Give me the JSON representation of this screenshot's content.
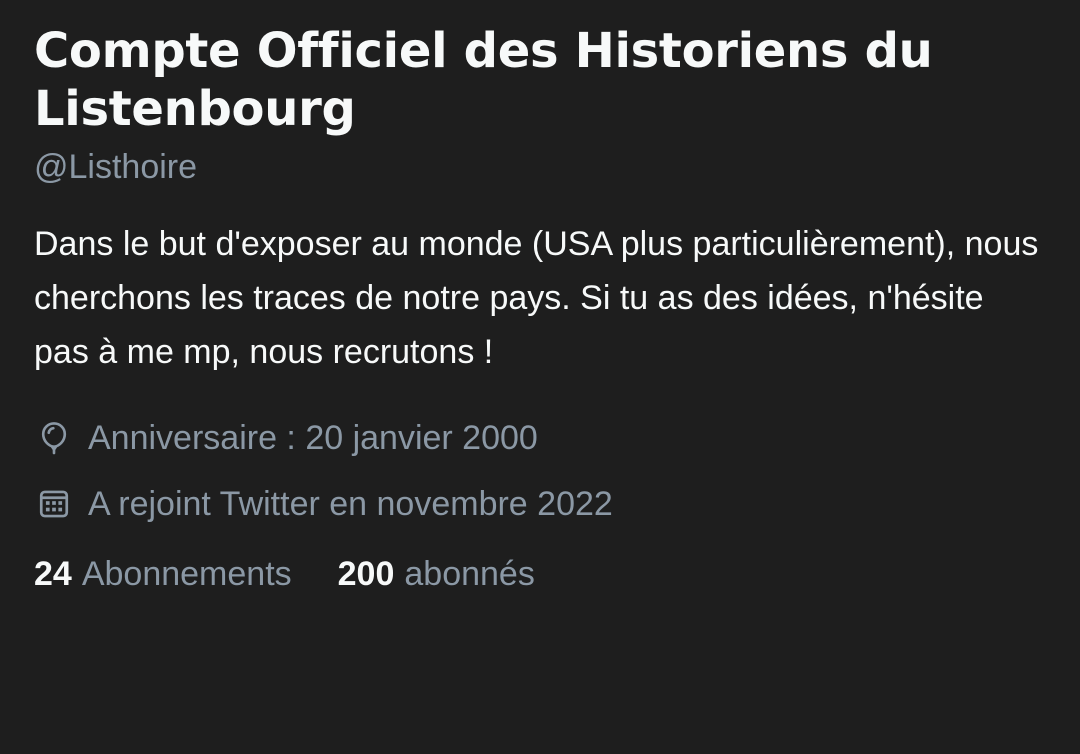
{
  "profile": {
    "display_name": "Compte Officiel des Historiens du Listenbourg",
    "handle": "@Listhoire",
    "bio": "Dans le but d'exposer au monde (USA plus particulièrement), nous cherchons les traces de notre pays. Si tu as des idées, n'hésite pas à me mp, nous recrutons !",
    "birthday": {
      "icon": "balloon-icon",
      "text": "Anniversaire : 20 janvier 2000"
    },
    "joined": {
      "icon": "calendar-icon",
      "text": "A rejoint Twitter en novembre 2022"
    },
    "following": {
      "count": "24",
      "label": "Abonnements"
    },
    "followers": {
      "count": "200",
      "label": "abonnés"
    }
  },
  "colors": {
    "background": "#1e1e1e",
    "primary_text": "#f7f9f9",
    "secondary_text": "#8b98a5"
  }
}
